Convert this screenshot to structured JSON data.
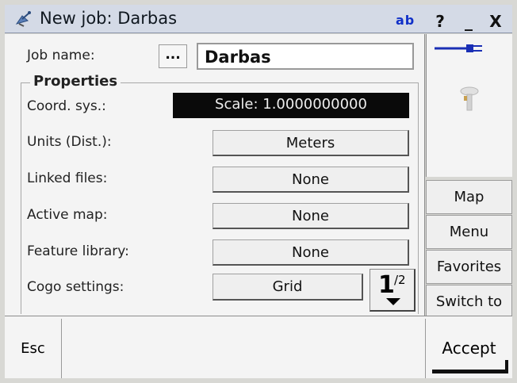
{
  "window": {
    "title": "New job: Darbas",
    "input_mode": "ab",
    "help_label": "?",
    "minimize_label": "_",
    "close_label": "X"
  },
  "job": {
    "name_label": "Job name:",
    "browse_label": "...",
    "name_value": "Darbas"
  },
  "properties": {
    "group_title": "Properties",
    "coord_label": "Coord. sys.:",
    "coord_value": "Scale: 1.0000000000",
    "units_label": "Units (Dist.):",
    "units_value": "Meters",
    "linked_label": "Linked files:",
    "linked_value": "None",
    "map_label": "Active map:",
    "map_value": "None",
    "feature_label": "Feature library:",
    "feature_value": "None",
    "cogo_label": "Cogo settings:",
    "cogo_value": "Grid"
  },
  "paging": {
    "current": "1",
    "total": "/2"
  },
  "side": {
    "map": "Map",
    "menu": "Menu",
    "favorites": "Favorites",
    "switch": "Switch to"
  },
  "footer": {
    "esc": "Esc",
    "accept": "Accept"
  },
  "colors": {
    "title_bg": "#d4dae6",
    "input_mode": "#1030c8",
    "connector": "#1a2fb5"
  },
  "icons": {
    "app": "satellite-dish-icon",
    "connection": "plug-connector-icon",
    "instrument": "gnss-receiver-icon"
  }
}
